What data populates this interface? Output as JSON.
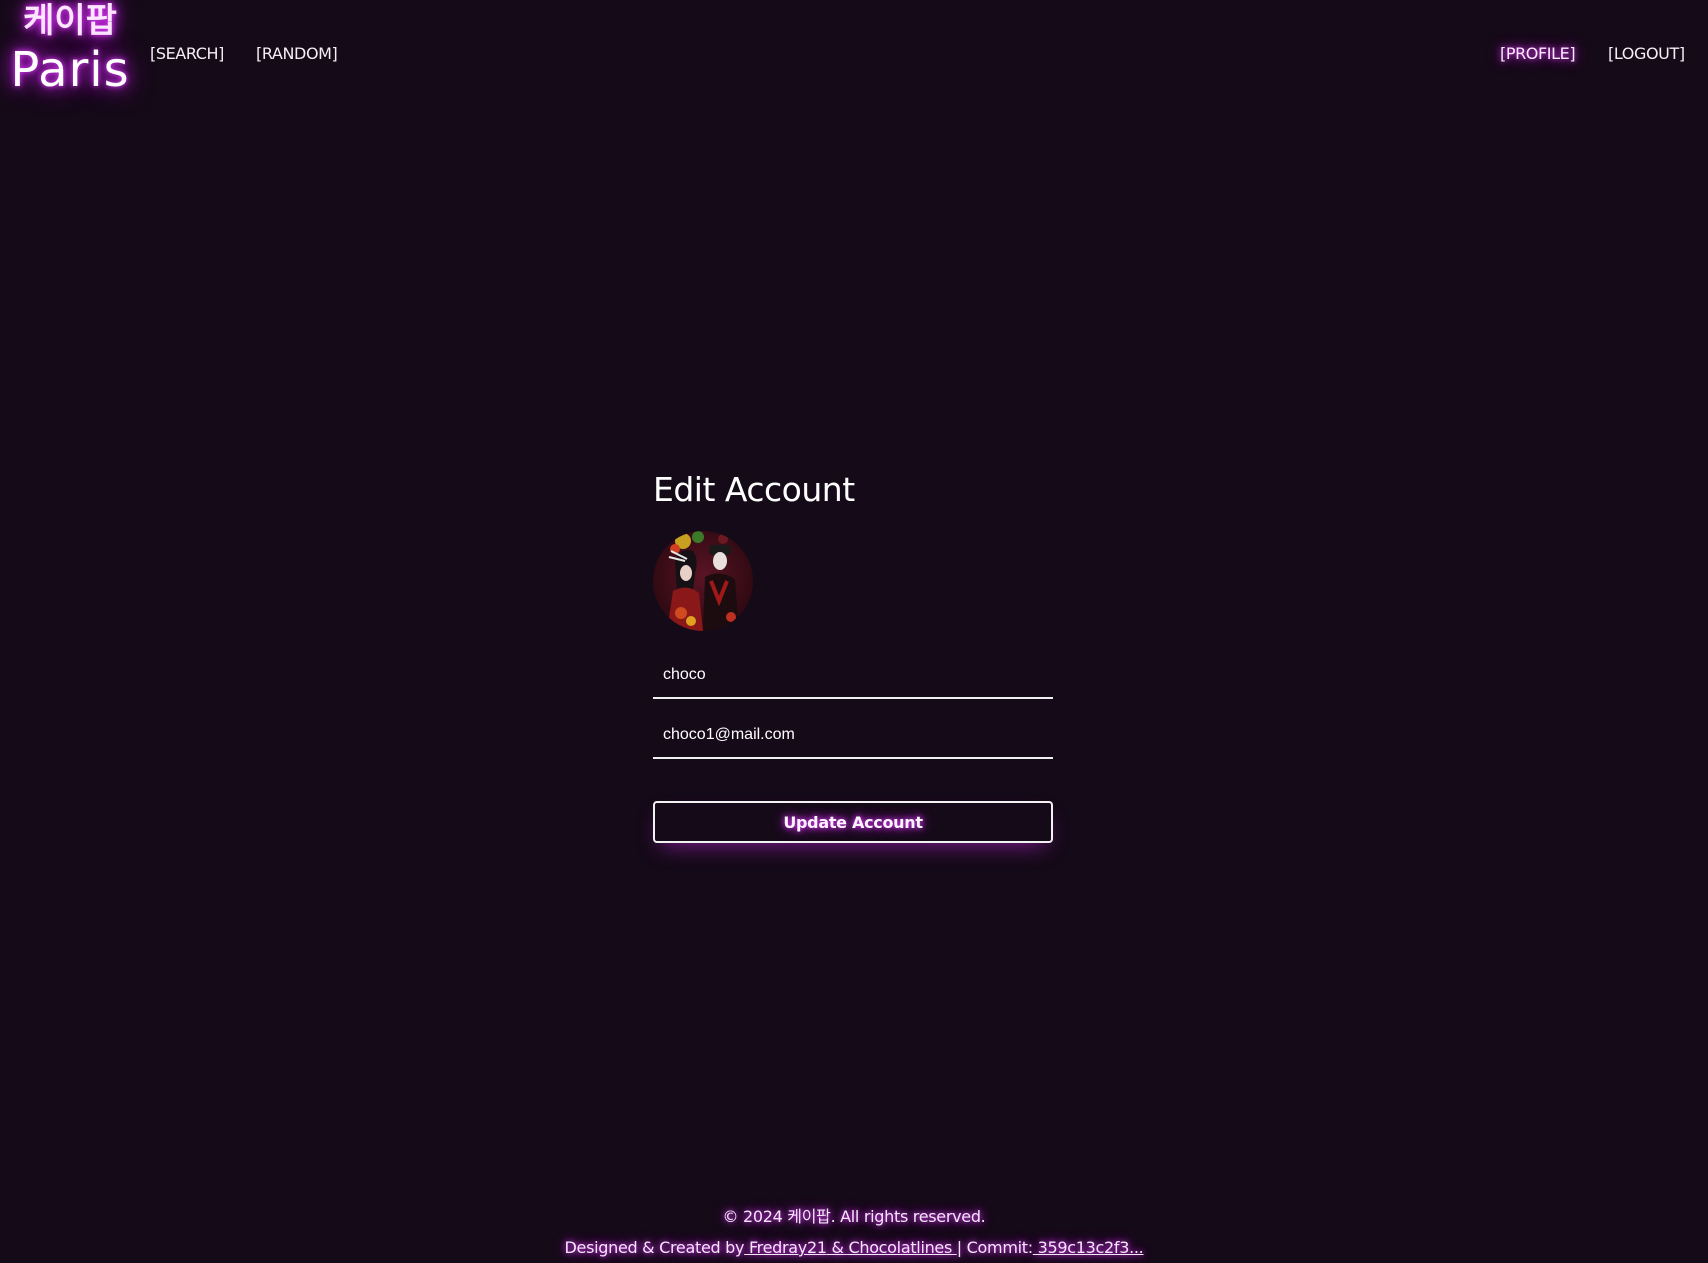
{
  "brand": {
    "korean": "케이팝",
    "name": "Paris"
  },
  "nav": {
    "search": "[SEARCH]",
    "random": "[RANDOM]",
    "profile": "[PROFILE]",
    "logout": "[LOGOUT]"
  },
  "form": {
    "title": "Edit Account",
    "username_value": "choco",
    "email_value": "choco1@mail.com",
    "submit_label": "Update Account"
  },
  "footer": {
    "copyright": "© 2024 케이팝. All rights reserved.",
    "credits_prefix": "Designed & Created by",
    "author1": " Fredray21",
    "separator": " & ",
    "author2": "Chocolatlines ",
    "commit_prefix": "| Commit:",
    "commit_hash": " 359c13c2f3..."
  },
  "colors": {
    "background": "#150a18",
    "neon_glow": "#e040ff",
    "text": "#ffffff"
  }
}
